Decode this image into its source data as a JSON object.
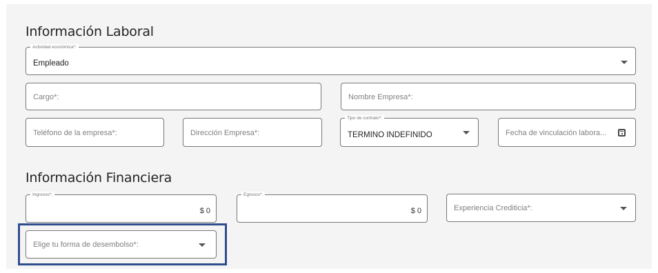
{
  "laboral": {
    "title": "Información Laboral",
    "actividad": {
      "label": "Actividad económica*:",
      "value": "Empleado"
    },
    "cargo": {
      "placeholder": "Cargo*:"
    },
    "nombre_empresa": {
      "placeholder": "Nombre Empresa*:"
    },
    "telefono": {
      "placeholder": "Teléfono de la empresa*:"
    },
    "direccion": {
      "placeholder": "Dirección Empresa*:"
    },
    "tipo_contrato": {
      "label": "Tipo de contrato*:",
      "value": "TERMINO INDEFINIDO"
    },
    "fecha_vinculacion": {
      "placeholder": "Fecha de vinculación labora..."
    }
  },
  "financiera": {
    "title": "Información Financiera",
    "ingresos": {
      "label": "Ingresos*:",
      "value": "$ 0"
    },
    "egresos": {
      "label": "Egresos*:",
      "value": "$ 0"
    },
    "experiencia": {
      "placeholder": "Experiencia Crediticia*:"
    },
    "desembolso": {
      "placeholder": "Elige tu forma de desembolso*:"
    }
  },
  "colors": {
    "highlight_border": "#2f4d8c",
    "panel_background": "#f4f4f5",
    "field_border": "#777777"
  },
  "icons": {
    "dropdown": "chevron-down-icon",
    "date": "calendar-icon"
  }
}
